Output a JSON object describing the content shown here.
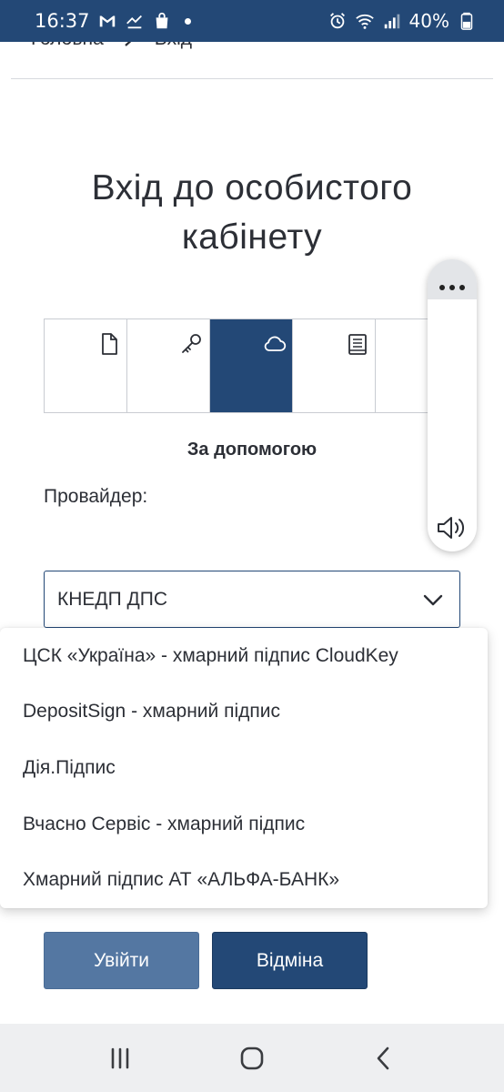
{
  "status_bar": {
    "time": "16:37",
    "battery": "40%",
    "icons": [
      "gmail-icon",
      "missed-call-icon",
      "shopping-bag-icon",
      "notification-dot",
      "alarm-icon",
      "wifi-icon",
      "signal-icon",
      "battery-icon"
    ]
  },
  "breadcrumb": {
    "home": "Головна",
    "current": "Вхід"
  },
  "page": {
    "title_line1": "Вхід до особистого",
    "title_line2": "кабінету"
  },
  "tabs": [
    {
      "icon": "file-icon",
      "active": false
    },
    {
      "icon": "key-icon",
      "active": false
    },
    {
      "icon": "cloud-icon",
      "active": true
    },
    {
      "icon": "book-icon",
      "active": false
    },
    {
      "icon": "extra-icon",
      "active": false
    }
  ],
  "subtitle": "За допомогою",
  "provider": {
    "label": "Провайдер:",
    "selected": "КНЕДП ДПС",
    "options": [
      "ЦСК «Україна» - хмарний підпис CloudKey",
      "DepositSign - хмарний підпис",
      "Дія.Підпис",
      "Вчасно Сервіс - хмарний підпис",
      "Хмарний підпис АТ «АЛЬФА-БАНК»"
    ]
  },
  "buttons": {
    "login": "Увійти",
    "cancel": "Відміна"
  },
  "colors": {
    "primary": "#234876",
    "login_button": "#5477a2",
    "nav_bar": "#eeeff1"
  }
}
